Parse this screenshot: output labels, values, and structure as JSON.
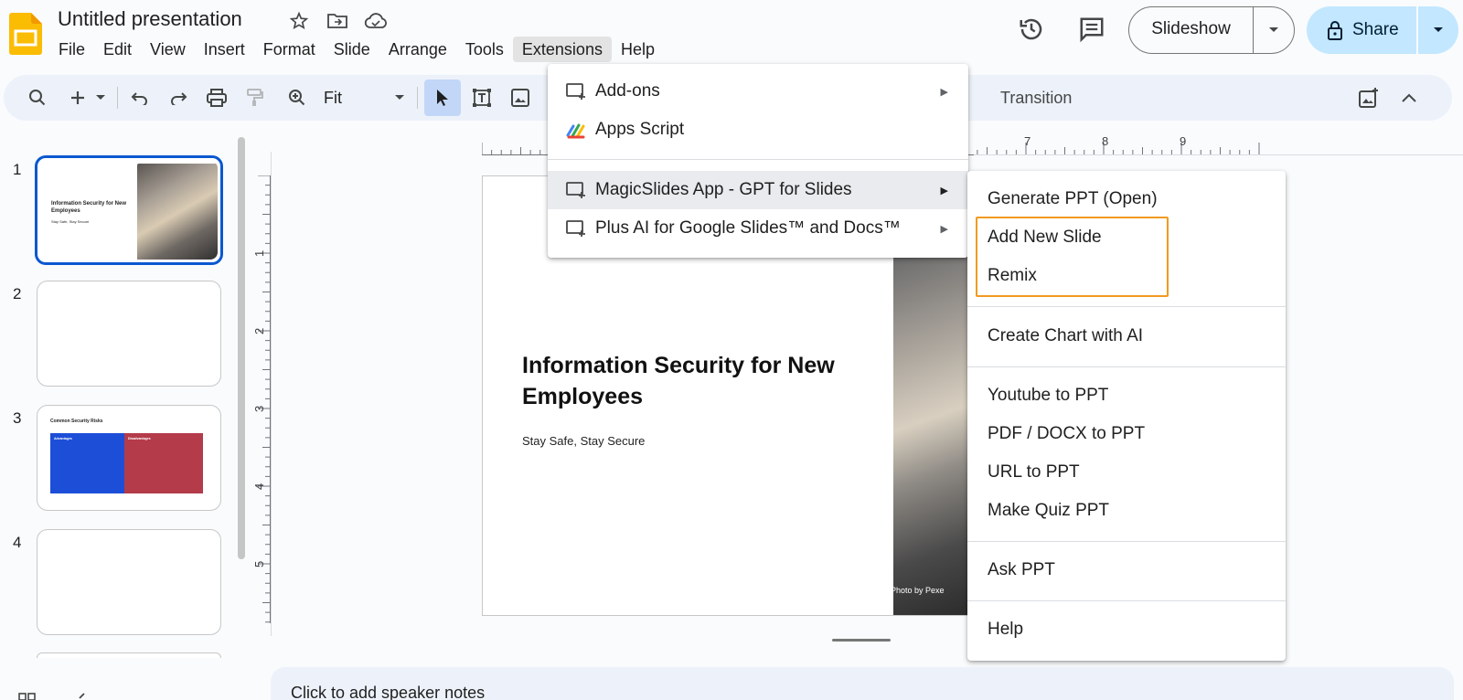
{
  "doc": {
    "title": "Untitled presentation"
  },
  "menubar": {
    "items": [
      "File",
      "Edit",
      "View",
      "Insert",
      "Format",
      "Slide",
      "Arrange",
      "Tools",
      "Extensions",
      "Help"
    ],
    "active": "Extensions"
  },
  "header": {
    "slideshow_label": "Slideshow",
    "share_label": "Share"
  },
  "toolbar": {
    "zoom_label": "Fit",
    "transition_label": "Transition"
  },
  "filmstrip": {
    "numbers": [
      "1",
      "2",
      "3",
      "4"
    ],
    "thumb1": {
      "title": "Information Security for New Employees",
      "subtitle": "Stay Safe, Stay Secure"
    },
    "thumb3": {
      "title": "Common Security Risks",
      "left_head": "Advantages",
      "right_head": "Disadvantages"
    }
  },
  "rulers": {
    "h_labels": [
      "7",
      "8",
      "9"
    ],
    "v_labels": [
      "1",
      "2",
      "3",
      "4",
      "5"
    ]
  },
  "slide": {
    "title": "Information Security for New Employees",
    "subtitle": "Stay Safe, Stay Secure",
    "photo_credit": "Photo by Pexe"
  },
  "notes": {
    "placeholder": "Click to add speaker notes"
  },
  "extensions_menu": {
    "items": [
      {
        "label": "Add-ons",
        "icon": "addon-icon",
        "submenu": true
      },
      {
        "label": "Apps Script",
        "icon": "apps-script-icon",
        "submenu": false
      },
      {
        "label": "MagicSlides App - GPT for Slides",
        "icon": "addon-icon",
        "submenu": true
      },
      {
        "label": "Plus AI for Google Slides™ and Docs™",
        "icon": "addon-icon",
        "submenu": true
      }
    ]
  },
  "magicslides_submenu": {
    "items": [
      "Generate PPT (Open)",
      "Add New Slide",
      "Remix",
      "Create Chart with AI",
      "Youtube to PPT",
      "PDF / DOCX to PPT",
      "URL to PPT",
      "Make Quiz PPT",
      "Ask PPT",
      "Help"
    ],
    "highlight_color": "#f29a1f"
  },
  "colors": {
    "accent": "#0b57d0",
    "share_bg": "#c2e7ff",
    "toolbar_bg": "#edf2fa",
    "thumb3_left": "#1d4ed8",
    "thumb3_right": "#b43b4a"
  }
}
